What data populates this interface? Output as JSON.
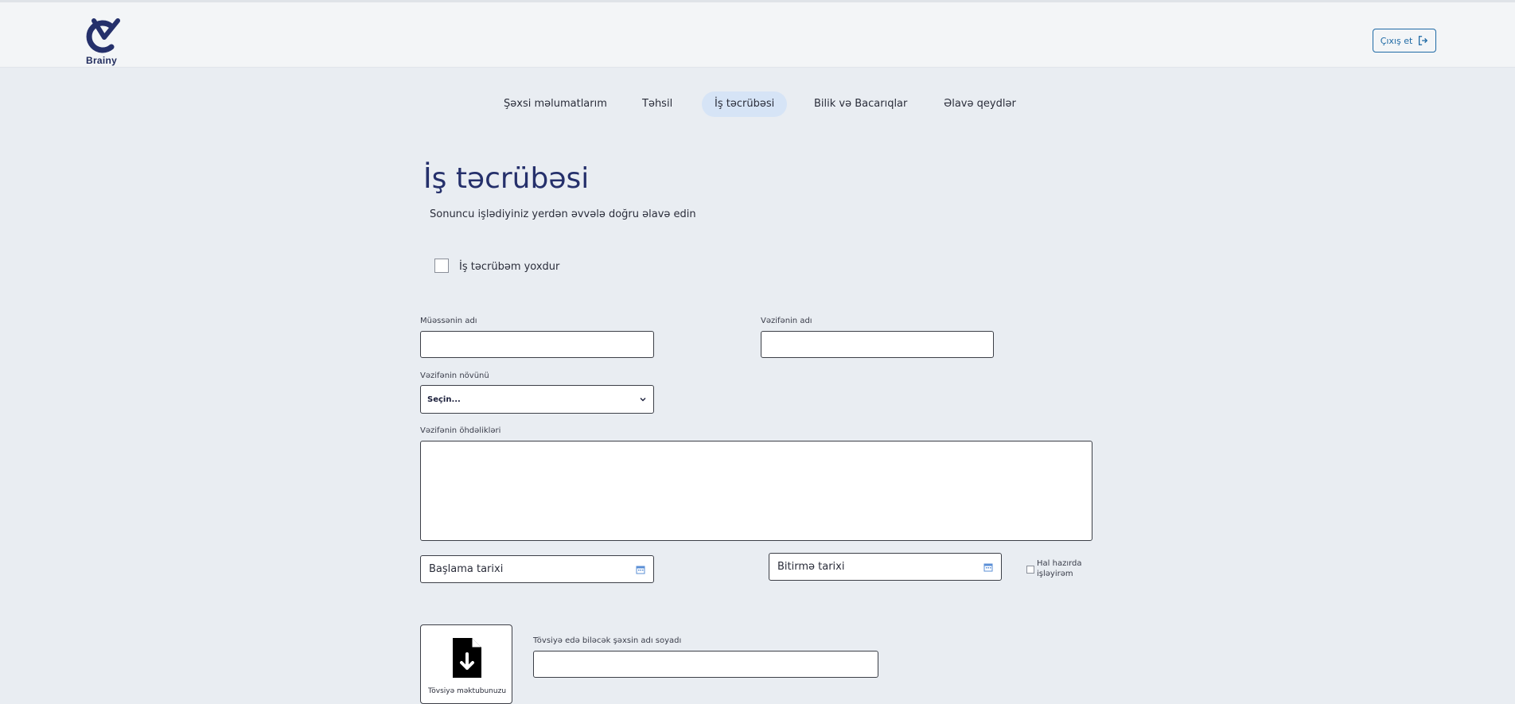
{
  "header": {
    "logo_text": "Brainy",
    "logout_label": "Çıxış et"
  },
  "tabs": [
    {
      "label": "Şəxsi məlumatlarım",
      "active": false
    },
    {
      "label": "Təhsil",
      "active": false
    },
    {
      "label": "İş təcrübəsi",
      "active": true
    },
    {
      "label": "Bilik və Bacarıqlar",
      "active": false
    },
    {
      "label": "Əlavə qeydlər",
      "active": false
    }
  ],
  "main": {
    "title": "İş təcrübəsi",
    "subtitle": "Sonuncu işlədiyiniz yerdən əvvələ doğru əlavə edin",
    "no_experience_label": "İş təcrübəm yoxdur",
    "institution_label": "Müəssənin adı",
    "position_label": "Vəzifənin adı",
    "position_type_label": "Vəzifənin növünü",
    "position_type_value": "Seçin...",
    "duties_label": "Vəzifənin öhdəlikləri",
    "start_date_placeholder": "Başlama tarixi",
    "end_date_placeholder": "Bitirmə tarixi",
    "currently_working_label": "Hal hazırda işləyirəm",
    "reference_label": "Tövsiyə edə biləcək şəxsin adı soyadı",
    "upload_caption": "Tövsiyə məktubunuzu"
  },
  "colors": {
    "accent": "#1f6aa5",
    "title": "#25306b",
    "active_tab_bg": "#d6e4f6",
    "page_bg": "#e9edf2",
    "header_bg": "#f3f5f7"
  },
  "icons": {
    "logo": "cv-logo-icon",
    "logout": "logout-icon",
    "select_caret": "chevron-down-icon",
    "calendar": "calendar-icon",
    "upload": "file-download-icon"
  }
}
